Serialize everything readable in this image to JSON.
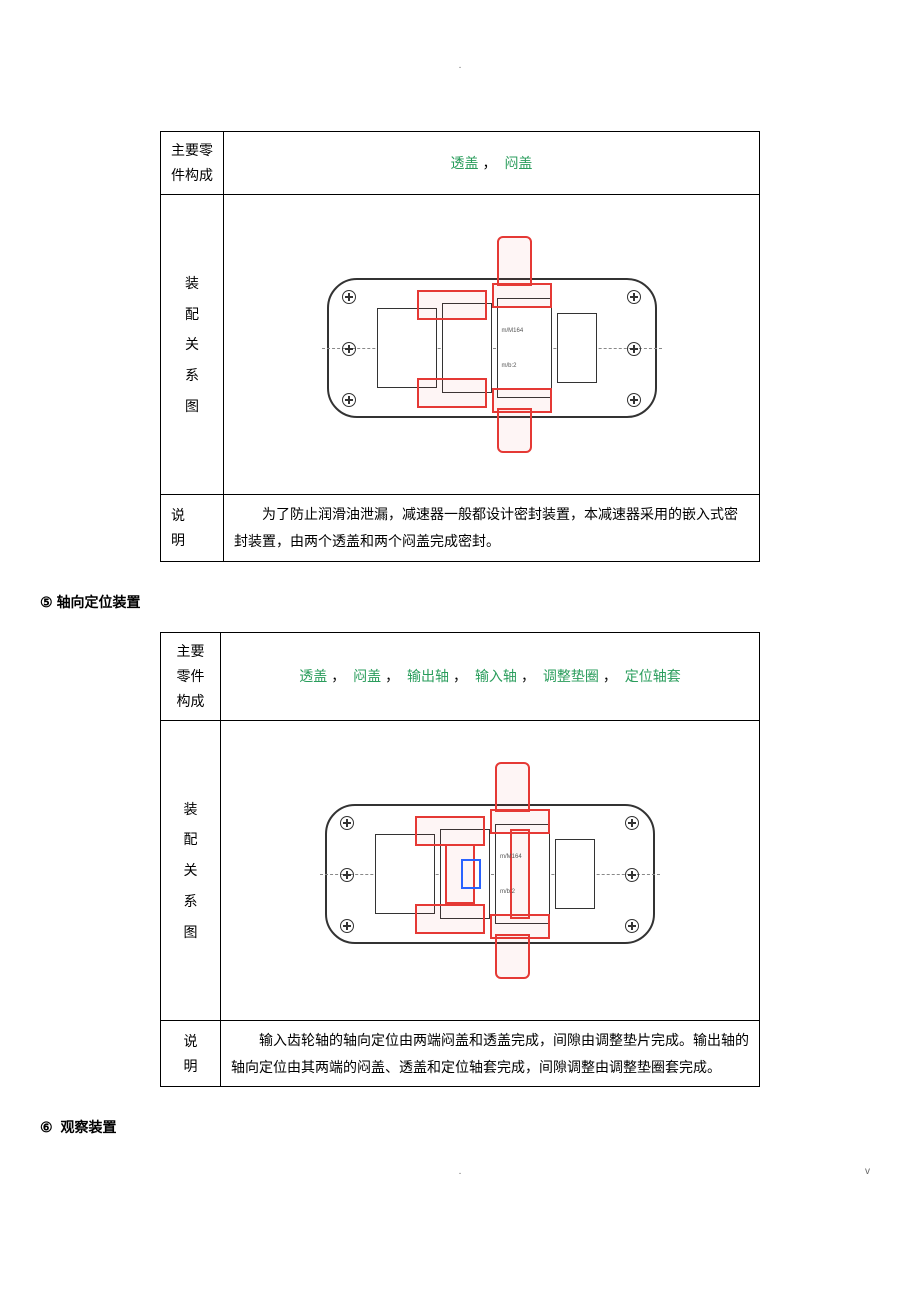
{
  "topDot": ".",
  "table1": {
    "partsLabel": "主要零件构成",
    "parts": [
      "透盖",
      "闷盖"
    ],
    "sep": "，",
    "diagramLabel": "装配关系图",
    "descLabel": "说明",
    "description": "为了防止润滑油泄漏，减速器一般都设计密封装置，本减速器采用的嵌入式密封装置，由两个透盖和两个闷盖完成密封。"
  },
  "heading5": {
    "num": "⑤",
    "text": "轴向定位装置"
  },
  "table2": {
    "partsLabel": "主要零件构成",
    "parts": [
      "透盖",
      "闷盖",
      "输出轴",
      "输入轴",
      "调整垫圈",
      "定位轴套"
    ],
    "sep": "，",
    "diagramLabel": "装配关系图",
    "descLabel": "说明",
    "description": "输入齿轮轴的轴向定位由两端闷盖和透盖完成，间隙由调整垫片完成。输出轴的轴向定位由其两端的闷盖、透盖和定位轴套完成，间隙调整由调整垫圈套完成。"
  },
  "heading6": {
    "num": "⑥",
    "text": "观察装置"
  },
  "footerDot": ".",
  "footerV": "v"
}
